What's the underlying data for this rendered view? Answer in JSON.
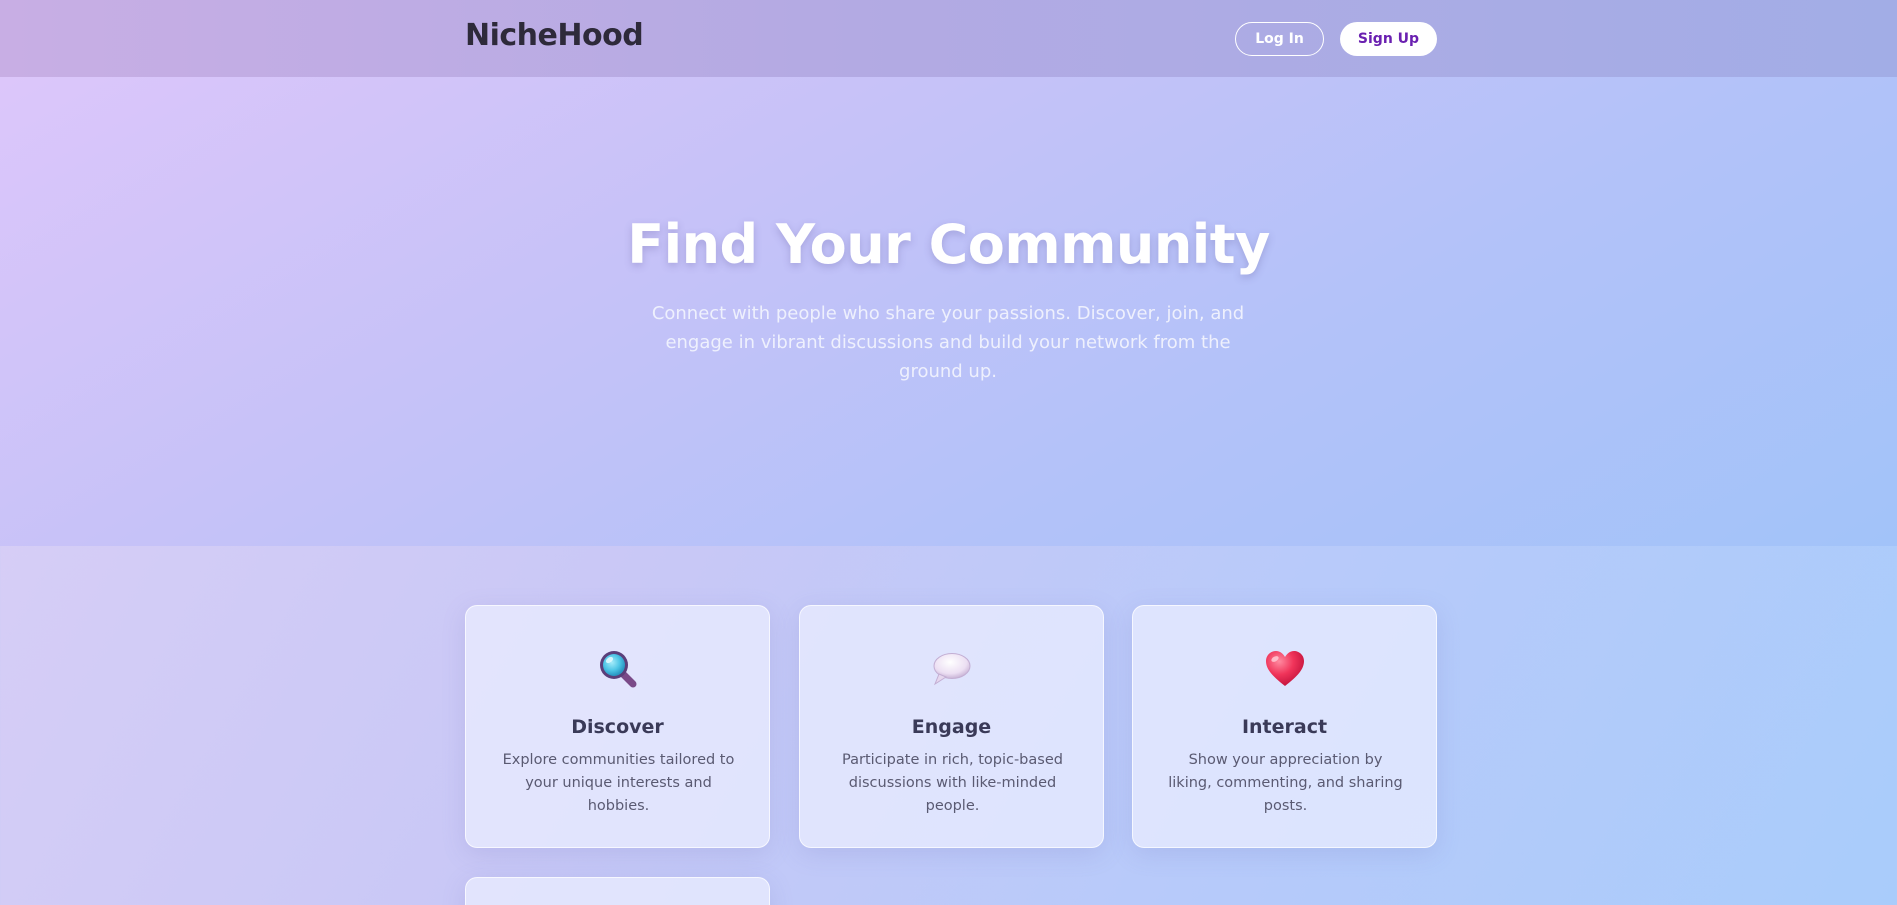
{
  "header": {
    "logo": "NicheHood",
    "login_label": "Log In",
    "signup_label": "Sign Up"
  },
  "hero": {
    "title": "Find Your Community",
    "subtitle": "Connect with people who share your passions. Discover, join, and engage in vibrant discussions and build your network from the ground up."
  },
  "features": [
    {
      "icon": "magnifying-glass-icon",
      "title": "Discover",
      "description": "Explore communities tailored to your unique interests and hobbies."
    },
    {
      "icon": "speech-bubble-icon",
      "title": "Engage",
      "description": "Participate in rich, topic-based discussions with like-minded people."
    },
    {
      "icon": "heart-icon",
      "title": "Interact",
      "description": "Show your appreciation by liking, commenting, and sharing posts."
    }
  ],
  "colors": {
    "accent": "#6a20b0",
    "heart": "#f0345a",
    "magnifier_lens": "#4fc6e6"
  }
}
